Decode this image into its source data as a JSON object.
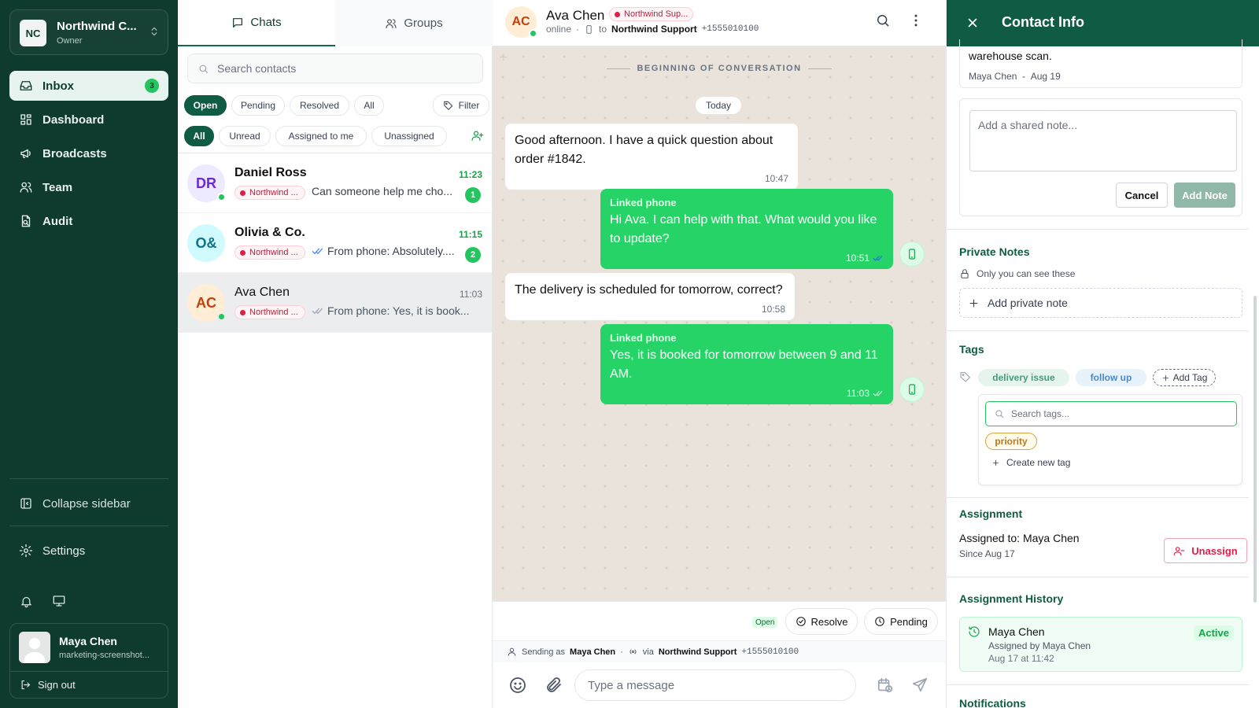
{
  "sidebar": {
    "org": {
      "initials": "NC",
      "name": "Northwind C...",
      "role": "Owner"
    },
    "nav": [
      {
        "label": "Inbox",
        "badge": "3"
      },
      {
        "label": "Dashboard"
      },
      {
        "label": "Broadcasts"
      },
      {
        "label": "Team"
      },
      {
        "label": "Audit"
      }
    ],
    "collapse_label": "Collapse sidebar",
    "settings_label": "Settings",
    "user": {
      "name": "Maya Chen",
      "email": "marketing-screenshot..."
    },
    "signout_label": "Sign out"
  },
  "list": {
    "tabs": [
      {
        "label": "Chats"
      },
      {
        "label": "Groups"
      }
    ],
    "search_placeholder": "Search contacts",
    "status_filters": [
      "Open",
      "Pending",
      "Resolved",
      "All"
    ],
    "filter_label": "Filter",
    "scope_filters": [
      "All",
      "Unread",
      "Assigned to me",
      "Unassigned"
    ],
    "conversations": [
      {
        "initials": "DR",
        "name": "Daniel Ross",
        "time": "11:23",
        "tag": "Northwind ...",
        "preview": "Can someone help me cho...",
        "unread": "1"
      },
      {
        "initials": "O&",
        "name": "Olivia & Co.",
        "time": "11:15",
        "tag": "Northwind ...",
        "preview": "From phone: Absolutely....",
        "unread": "2"
      },
      {
        "initials": "AC",
        "name": "Ava Chen",
        "time": "11:03",
        "tag": "Northwind ...",
        "preview": "From phone: Yes, it is book..."
      }
    ]
  },
  "chat": {
    "contact": {
      "initials": "AC",
      "name": "Ava Chen",
      "badge": "Northwind Sup...",
      "status": "online",
      "to_label": "to",
      "channel": "Northwind Support",
      "number": "+1555010100"
    },
    "beginning_label": "BEGINNING OF CONVERSATION",
    "day_label": "Today",
    "messages": [
      {
        "text": "Good afternoon. I have a quick question about order #1842.",
        "time": "10:47"
      },
      {
        "label": "Linked phone",
        "text": "Hi Ava. I can help with that. What would you like to update?",
        "time": "10:51"
      },
      {
        "text": "The delivery is scheduled for tomorrow, correct?",
        "time": "10:58"
      },
      {
        "label": "Linked phone",
        "text": "Yes, it is booked for tomorrow between 9 and 11 AM.",
        "time": "11:03"
      }
    ],
    "status_chip": "Open",
    "resolve_label": "Resolve",
    "pending_label": "Pending",
    "sending": {
      "prefix": "Sending as",
      "name": "Maya Chen",
      "via": "via",
      "channel": "Northwind Support",
      "number": "+1555010100"
    },
    "composer_placeholder": "Type a message"
  },
  "info": {
    "title": "Contact Info",
    "shared_note": {
      "text": "warehouse scan.",
      "author": "Maya Chen",
      "sep": "-",
      "date": "Aug 19"
    },
    "shared_placeholder": "Add a shared note...",
    "cancel_label": "Cancel",
    "add_note_label": "Add Note",
    "private": {
      "title": "Private Notes",
      "hint": "Only you can see these",
      "add_label": "Add private note"
    },
    "tags": {
      "title": "Tags",
      "items": [
        "delivery issue",
        "follow up"
      ],
      "add_label": "Add Tag",
      "search_placeholder": "Search tags...",
      "suggestion": "priority",
      "create_label": "Create new tag"
    },
    "assignment": {
      "title": "Assignment",
      "assigned_label": "Assigned to:",
      "assignee": "Maya Chen",
      "since": "Since Aug 17",
      "unassign_label": "Unassign"
    },
    "history": {
      "title": "Assignment History",
      "name": "Maya Chen",
      "by": "Assigned by Maya Chen",
      "when": "Aug 17 at 11:42",
      "status": "Active"
    },
    "notifications_title": "Notifications"
  },
  "colors": {
    "sidebar": "#0f3b2e",
    "accent": "#0f5b44",
    "bubble_out": "#25d366",
    "chat_bg": "#e9e3dc",
    "danger": "#e11d48"
  }
}
